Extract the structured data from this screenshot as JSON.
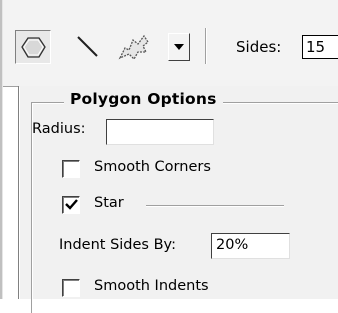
{
  "toolbar": {
    "tools": [
      {
        "name": "polygon-tool",
        "selected": true
      },
      {
        "name": "line-tool",
        "selected": false
      },
      {
        "name": "custom-shape-tool",
        "selected": false
      }
    ],
    "dropdown_icon": "triangle-down-icon",
    "sides_label": "Sides:",
    "sides_value": "15"
  },
  "polygon_options": {
    "title": "Polygon Options",
    "radius_label": "Radius:",
    "radius_value": "",
    "smooth_corners_label": "Smooth Corners",
    "smooth_corners_checked": false,
    "star_label": "Star",
    "star_checked": true,
    "indent_label": "Indent Sides By:",
    "indent_value": "20%",
    "smooth_indents_label": "Smooth Indents",
    "smooth_indents_checked": false
  }
}
